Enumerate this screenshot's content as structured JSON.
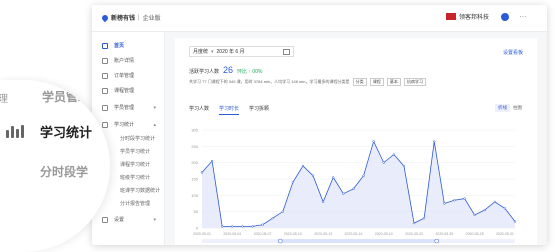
{
  "topbar": {
    "brand": "新榜有钱",
    "brand_sub": "企业版",
    "company": "领客邦科技",
    "menu": "···"
  },
  "sidebar": {
    "items": [
      {
        "label": "首页",
        "active": true
      },
      {
        "label": "账户详情"
      },
      {
        "label": "订单管理"
      },
      {
        "label": "课程管理"
      },
      {
        "label": "学员管理",
        "caret": "▾"
      },
      {
        "label": "学习统计",
        "caret": "▴"
      }
    ],
    "sub_items": [
      "分时段学习统计",
      "学员学习统计",
      "课程学习统计",
      "班级学习统计",
      "班课学习数据统计",
      "分计报告管理"
    ],
    "last": {
      "label": "设置",
      "caret": "▾"
    }
  },
  "zoom": {
    "above": "学员管理",
    "above_tail": "理",
    "current": "学习统计",
    "below": "分时段学"
  },
  "filter": {
    "period": "月度统",
    "month": "2020 年 6 月",
    "settings_link": "设置看板"
  },
  "stats": {
    "label": "活跃学习人数",
    "value": "26",
    "change": "环比 ↑ 00%",
    "description": "共学习 77 门课程下的 349 课，用时 3784 min，人均学习 146 min，学习最多的课程分类是",
    "tags": [
      "分类",
      "课程",
      "基本",
      "抗病学习"
    ]
  },
  "tabs": [
    "学习人数",
    "学习时长",
    "学习拆颗"
  ],
  "active_tab": 1,
  "view_toggle": [
    "折线",
    "柱图"
  ],
  "chart_data": {
    "type": "area",
    "x": [
      "2020-05-01",
      "2020-05-02",
      "2020-05-03",
      "2020-05-04",
      "2020-05-05",
      "2020-05-06",
      "2020-05-07",
      "2020-05-08",
      "2020-05-09",
      "2020-05-10",
      "2020-05-11",
      "2020-05-12",
      "2020-05-13",
      "2020-05-14",
      "2020-05-15",
      "2020-05-16",
      "2020-05-17",
      "2020-05-18",
      "2020-05-19",
      "2020-05-20",
      "2020-05-21",
      "2020-05-22",
      "2020-05-23",
      "2020-05-24",
      "2020-05-25",
      "2020-05-26",
      "2020-05-27",
      "2020-05-28",
      "2020-05-29",
      "2020-05-30",
      "2020-05-31"
    ],
    "values": [
      170,
      205,
      5,
      5,
      5,
      5,
      10,
      30,
      50,
      140,
      190,
      160,
      80,
      155,
      105,
      120,
      160,
      265,
      200,
      225,
      190,
      15,
      30,
      265,
      75,
      85,
      90,
      40,
      55,
      80,
      60,
      20
    ],
    "ylim": [
      0,
      300
    ],
    "yticks": [
      0,
      50,
      100,
      150,
      200,
      250,
      300
    ],
    "xticks": [
      "2020-05-01",
      "2020-05-04",
      "2020-05-07",
      "2020-05-10",
      "2020-05-13",
      "2020-05-16",
      "2020-05-19",
      "2020-05-22",
      "2020-05-25",
      "2020-05-28",
      "2020-05-31"
    ],
    "color": "#2d5bd7",
    "fill": "#dfe6f9"
  }
}
